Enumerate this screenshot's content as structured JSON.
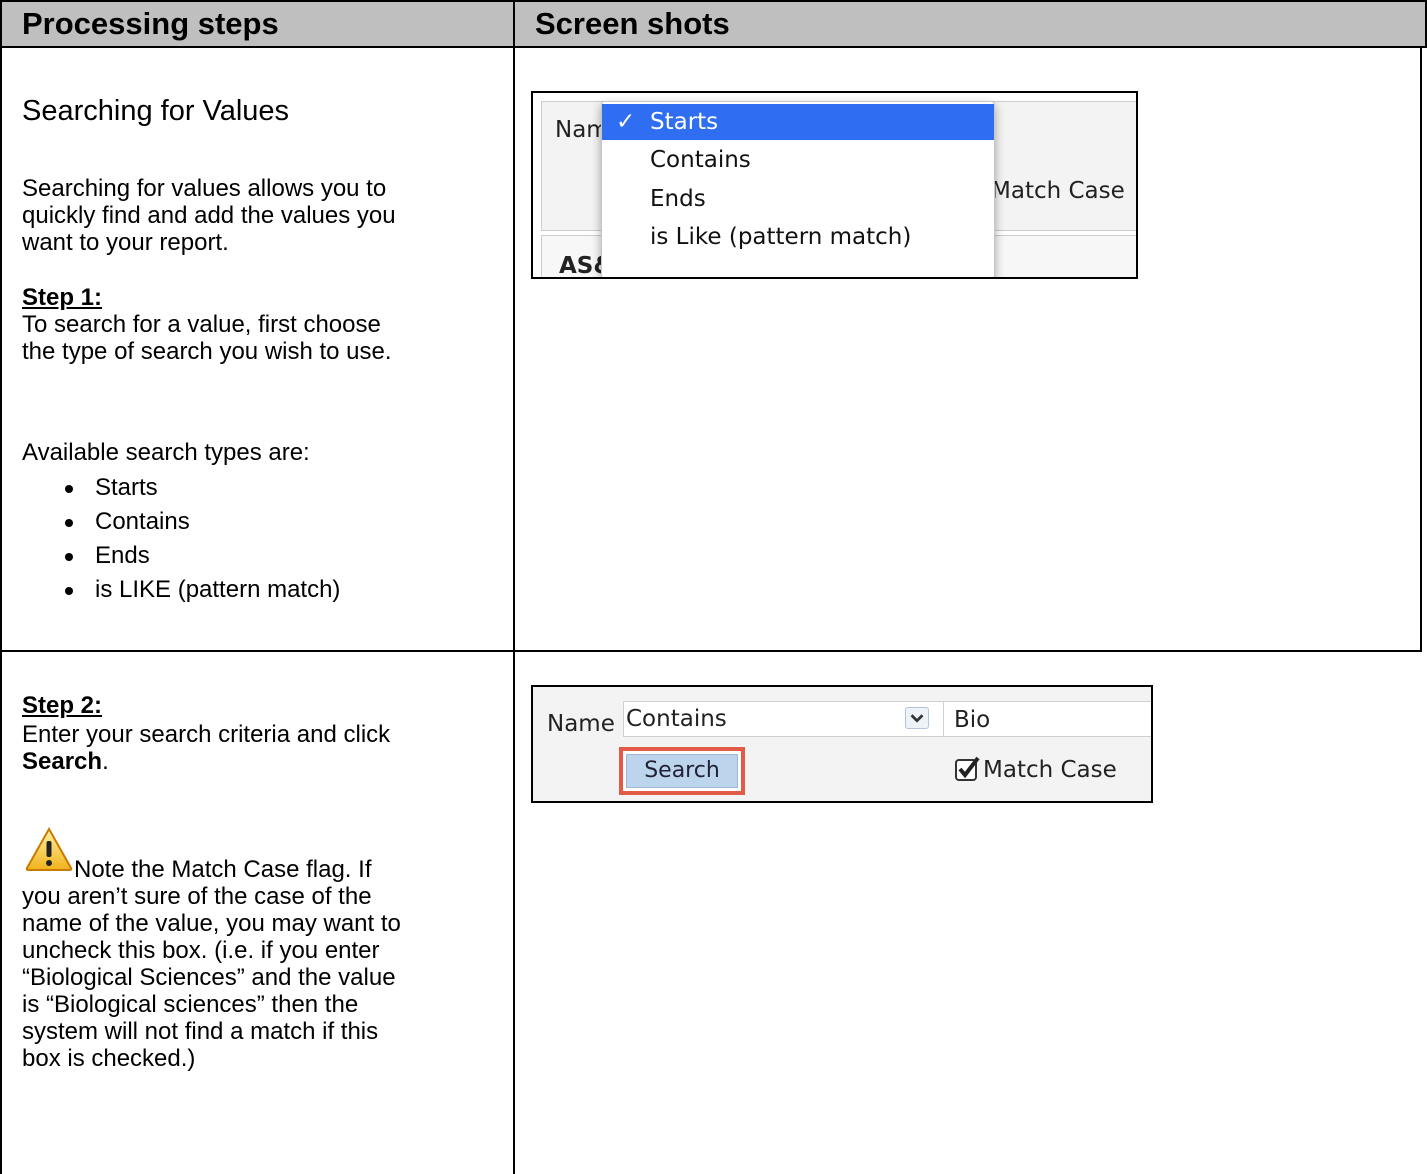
{
  "table": {
    "header_left": "Processing steps",
    "header_right": "Screen shots"
  },
  "section1": {
    "heading": "Searching for Values",
    "intro_line1": "Searching for values allows you to",
    "intro_line2": "quickly find and add the values you",
    "intro_line3": "want to your report.",
    "step_title": "Step 1:",
    "step_line1": "To search for a value, first choose",
    "step_line2": "the type of search you wish to use.",
    "available_label": "Available search types are:",
    "search_types": [
      "Starts",
      "Contains",
      "Ends",
      "is LIKE (pattern match)"
    ]
  },
  "section2": {
    "step_title": "Step 2:",
    "step_line1": "Enter your search criteria and click",
    "step_bold": "Search",
    "step_period": ".",
    "note_line1": "Note the Match Case flag. If",
    "note_line2": "you aren’t sure of the case of the",
    "note_line3": "name of the value, you may want to",
    "note_line4": "uncheck this box. (i.e. if you enter",
    "note_line5": "“Biological Sciences” and the value",
    "note_line6": "is “Biological sciences” then the",
    "note_line7": "system will not find a match if this",
    "note_line8": "box is checked.)"
  },
  "screenshot1": {
    "name_label": "Nam",
    "menu_items": [
      "Starts",
      "Contains",
      "Ends",
      "is Like (pattern match)"
    ],
    "tick": "✓",
    "match_case_partial": "Match Case",
    "row_text": "AS&",
    "selected_color": "#2f6df1"
  },
  "screenshot2": {
    "name_label": "Name",
    "select_value": "Contains",
    "input_value": "Bio",
    "search_button": "Search",
    "match_case": "Match Case",
    "highlight_color": "#e35a47"
  }
}
